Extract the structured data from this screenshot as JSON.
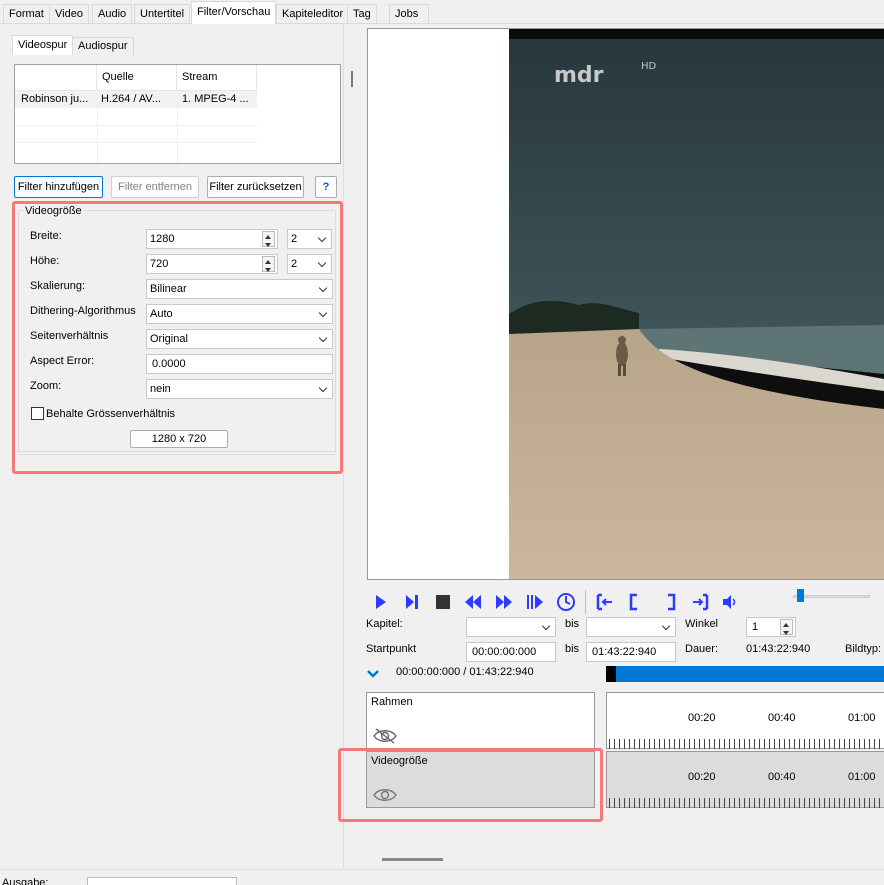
{
  "tabs": [
    "Format",
    "Video",
    "Audio",
    "Untertitel",
    "Filter/Vorschau",
    "Kapiteleditor",
    "Tag",
    "Jobs"
  ],
  "subtabs": [
    "Videospur",
    "Audiospur"
  ],
  "table": {
    "headers": [
      "",
      "Quelle",
      "Stream"
    ],
    "row": [
      "Robinson ju...",
      "H.264 / AV...",
      "1. MPEG-4 ..."
    ]
  },
  "buttons": {
    "add": "Filter hinzufügen",
    "remove": "Filter entfernen",
    "reset": "Filter zurücksetzen",
    "help": "?"
  },
  "videogroesse": {
    "legend": "Videogröße",
    "breite_label": "Breite:",
    "breite_value": "1280",
    "breite_mod": "2",
    "hoehe_label": "Höhe:",
    "hoehe_value": "720",
    "hoehe_mod": "2",
    "skalierung_label": "Skalierung:",
    "skalierung_value": "Bilinear",
    "dithering_label": "Dithering-Algorithmus",
    "dithering_value": "Auto",
    "seiten_label": "Seitenverhältnis",
    "seiten_value": "Original",
    "aspect_label": "Aspect Error:",
    "aspect_value": "0.0000",
    "zoom_label": "Zoom:",
    "zoom_value": "nein",
    "keep_label": "Behalte Grössenverhältnis",
    "keep_checked": false,
    "size_button": "1280 x 720"
  },
  "preview": {
    "logo": "mdr",
    "logo_sup": "HD"
  },
  "controls": {
    "kapitel_label": "Kapitel:",
    "bis1": "bis",
    "winkel_label": "Winkel",
    "winkel_value": "1",
    "startpunkt_label": "Startpunkt",
    "start_value": "00:00:00:000",
    "bis2": "bis",
    "end_value": "01:43:22:940",
    "dauer_label": "Dauer:",
    "dauer_value": "01:43:22:940",
    "bildtyp_label": "Bildtyp:",
    "position_text": "00:00:00:000 / 01:43:22:940"
  },
  "timeline": {
    "track1": "Rahmen",
    "track2": "Videogröße",
    "ticks": [
      "00:20",
      "00:40",
      "01:00"
    ]
  },
  "footer": {
    "ausgabe_label": "Ausgabe:"
  },
  "colors": {
    "accent": "#0078d7",
    "highlight": "#f47a7a",
    "controls": "#2b3cff"
  }
}
